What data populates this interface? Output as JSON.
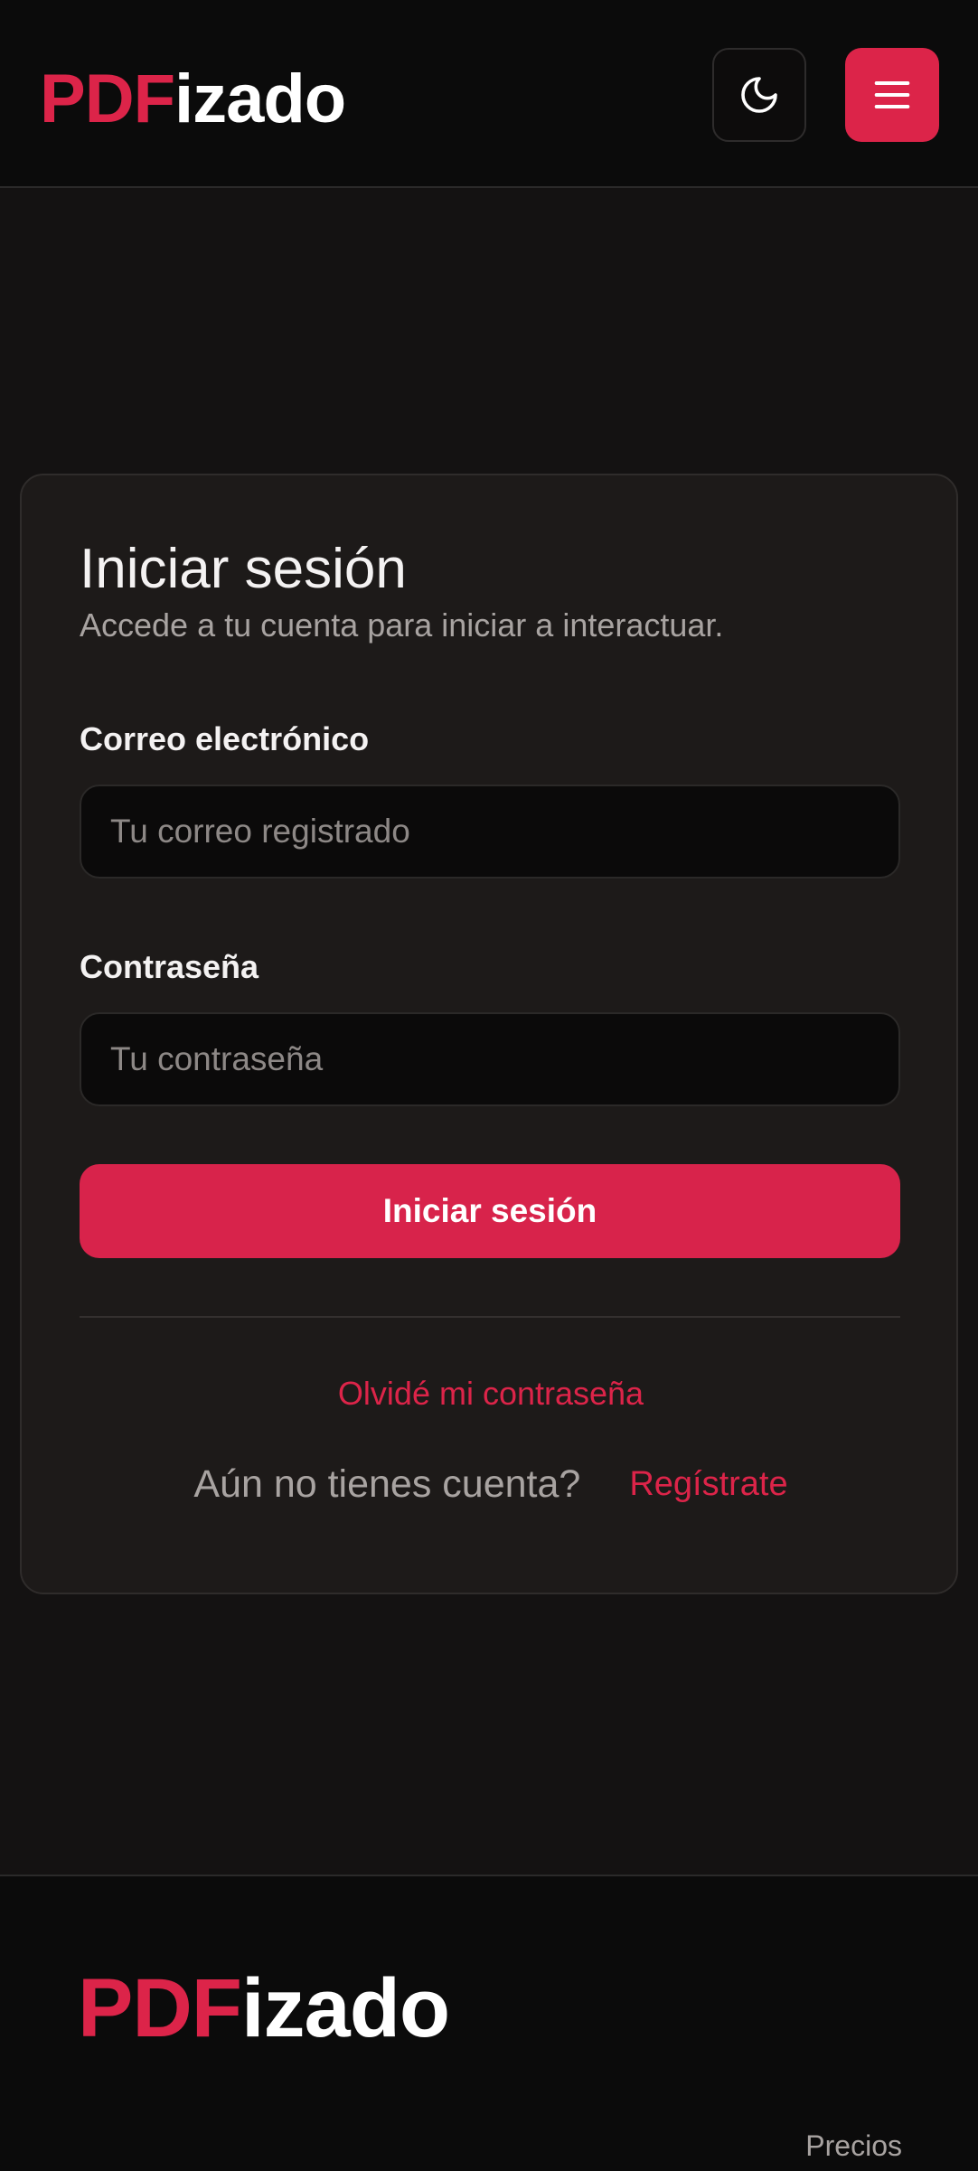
{
  "brand": {
    "logo_accent": "PDF",
    "logo_rest": "izado",
    "accent_color": "#dc2449"
  },
  "header": {
    "theme_toggle_icon": "moon-icon",
    "menu_icon": "hamburger-menu-icon"
  },
  "login": {
    "title": "Iniciar sesión",
    "subtitle": "Accede a tu cuenta para iniciar a interactuar.",
    "email_label": "Correo electrónico",
    "email_placeholder": "Tu correo registrado",
    "email_value": "",
    "password_label": "Contraseña",
    "password_placeholder": "Tu contraseña",
    "password_value": "",
    "submit_label": "Iniciar sesión",
    "forgot_label": "Olvidé mi contraseña",
    "no_account_text": "Aún no tienes cuenta?",
    "register_label": "Regístrate"
  },
  "footer": {
    "logo_accent": "PDF",
    "logo_rest": "izado",
    "links": [
      "Precios"
    ]
  }
}
